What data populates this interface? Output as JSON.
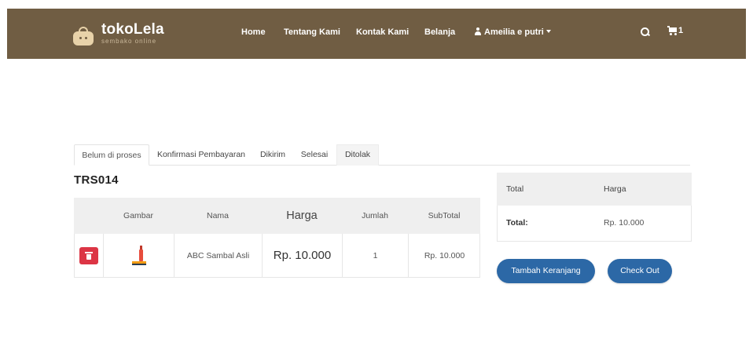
{
  "colors": {
    "navbar_bg": "#705d43",
    "primary_button": "#2c68a6",
    "delete_button": "#dc3545"
  },
  "brand": {
    "name": "tokoLela",
    "tagline": "sembako online",
    "icon": "shopping-bag-icon"
  },
  "nav": {
    "items": [
      {
        "label": "Home"
      },
      {
        "label": "Tentang Kami"
      },
      {
        "label": "Kontak Kami"
      },
      {
        "label": "Belanja"
      }
    ],
    "user": {
      "label": "Ameilia e putri",
      "icon": "user-icon"
    },
    "search_icon": "search-icon",
    "cart": {
      "count": "1",
      "icon": "cart-icon"
    }
  },
  "tabs": [
    {
      "label": "Belum di proses",
      "active": true
    },
    {
      "label": "Konfirmasi Pembayaran",
      "active": false
    },
    {
      "label": "Dikirim",
      "active": false
    },
    {
      "label": "Selesai",
      "active": false
    },
    {
      "label": "Ditolak",
      "active": false
    }
  ],
  "transaction_id": "TRS014",
  "cart_table": {
    "headers": [
      "",
      "Gambar",
      "Nama",
      "Harga",
      "Jumlah",
      "SubTotal"
    ],
    "rows": [
      {
        "delete_icon": "trash-icon",
        "image": "product-bottle-image",
        "nama": "ABC Sambal Asli",
        "harga": "Rp. 10.000",
        "jumlah": "1",
        "subtotal": "Rp. 10.000"
      }
    ]
  },
  "summary": {
    "headers": [
      "Total",
      "Harga"
    ],
    "row": {
      "label": "Total:",
      "value": "Rp. 10.000"
    }
  },
  "buttons": {
    "add_to_cart": "Tambah Keranjang",
    "checkout": "Check Out"
  }
}
